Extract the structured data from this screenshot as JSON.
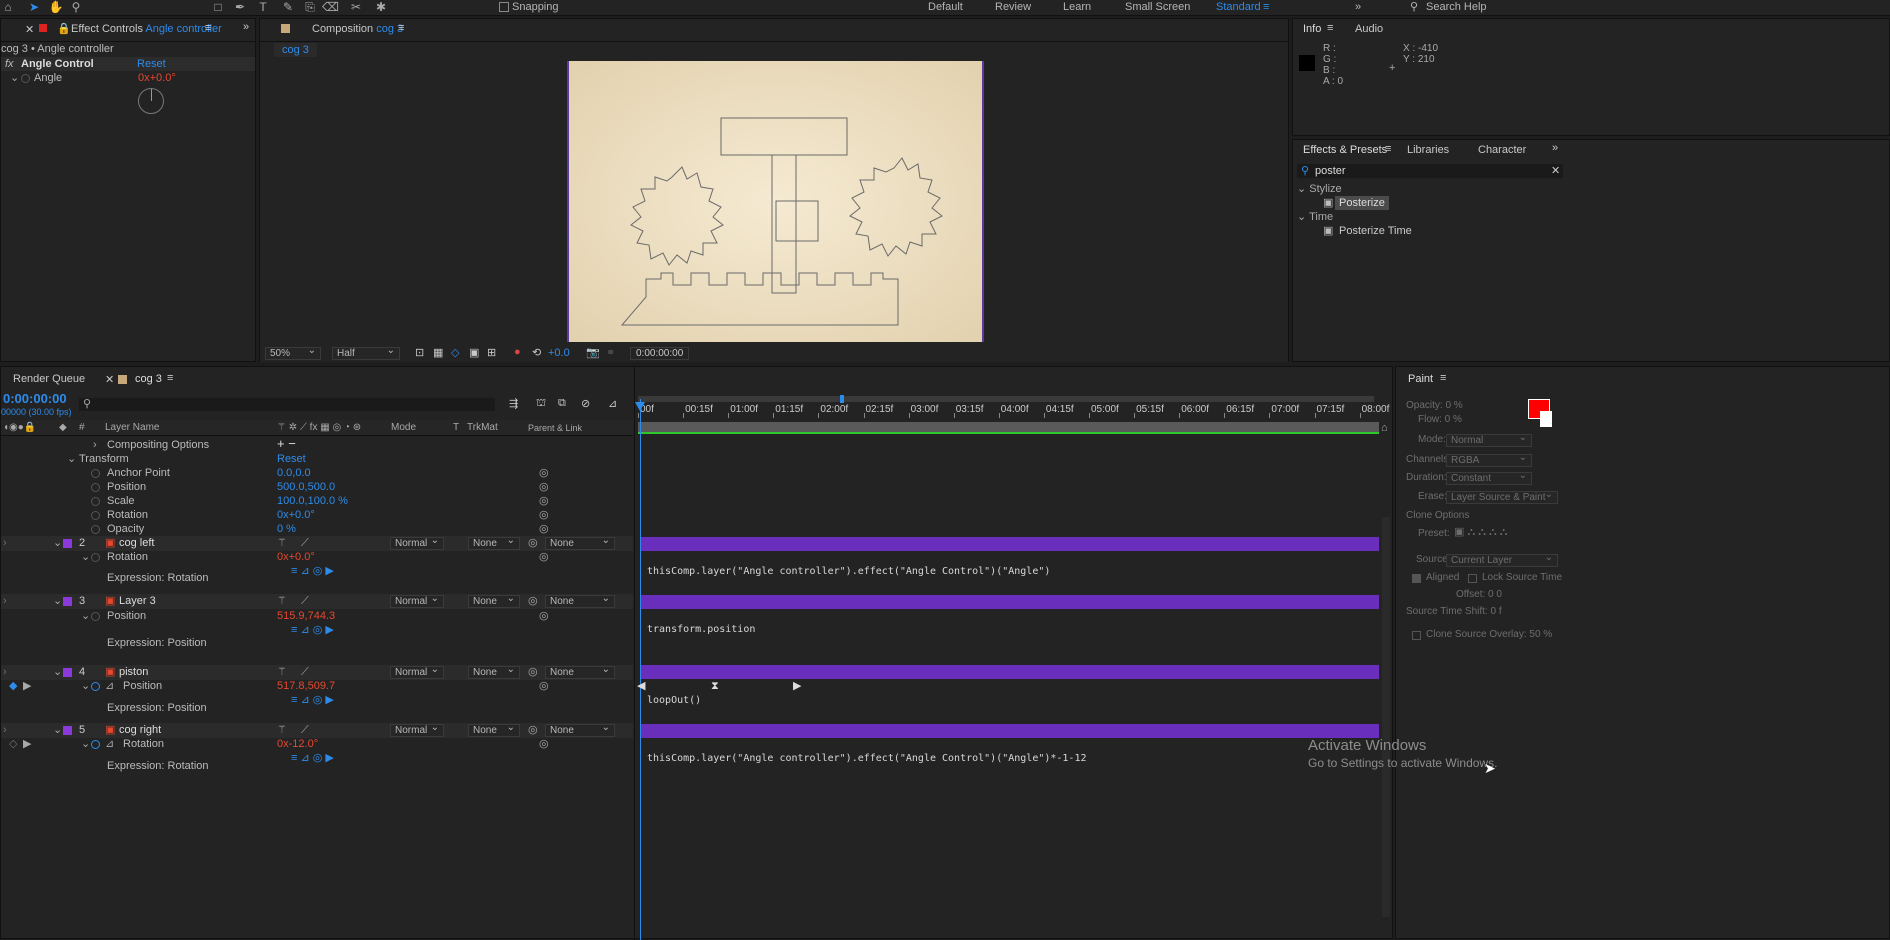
{
  "toolbar": {
    "snapping": "Snapping",
    "workspaces": [
      "Default",
      "Review",
      "Learn",
      "Small Screen",
      "Standard"
    ],
    "active_workspace": "Standard",
    "search_placeholder": "Search Help"
  },
  "effect_controls": {
    "tab_prefix": "Effect Controls",
    "tab_layer": "Angle controller",
    "breadcrumb": "cog 3 • Angle controller",
    "effect_name": "Angle Control",
    "reset": "Reset",
    "prop": "Angle",
    "value": "0x+0.0°"
  },
  "composition": {
    "tab_prefix": "Composition",
    "tab_name": "cog 3",
    "subtab": "cog 3",
    "zoom": "50%",
    "resolution": "Half",
    "exposure": "+0.0",
    "timecode": "0:00:00:00"
  },
  "info": {
    "tabs": [
      "Info",
      "Audio"
    ],
    "r": "R :",
    "g": "G :",
    "b": "B :",
    "a": "A : 0",
    "x": "X : -410",
    "y": "Y : 210"
  },
  "effects_presets": {
    "tabs": [
      "Effects & Presets",
      "Libraries",
      "Character"
    ],
    "search": "poster",
    "groups": [
      {
        "name": "Stylize",
        "item": "Posterize"
      },
      {
        "name": "Time",
        "item": "Posterize Time"
      }
    ]
  },
  "timeline": {
    "tabs": [
      "Render Queue",
      "cog 3"
    ],
    "timecode": "0:00:00:00",
    "fps": "00000 (30.00 fps)",
    "cols": {
      "layer_name": "Layer Name",
      "mode": "Mode",
      "t": "T",
      "trkmat": "TrkMat",
      "parent": "Parent & Link"
    },
    "ruler": [
      "00f",
      "00:15f",
      "01:00f",
      "01:15f",
      "02:00f",
      "02:15f",
      "03:00f",
      "03:15f",
      "04:00f",
      "04:15f",
      "05:00f",
      "05:15f",
      "06:00f",
      "06:15f",
      "07:00f",
      "07:15f",
      "08:00f"
    ],
    "compositing": "Compositing Options",
    "transform": "Transform",
    "reset": "Reset",
    "transform_props": [
      {
        "name": "Anchor Point",
        "value": "0.0,0.0"
      },
      {
        "name": "Position",
        "value": "500.0,500.0"
      },
      {
        "name": "Scale",
        "value": "100.0,100.0 %"
      },
      {
        "name": "Rotation",
        "value": "0x+0.0°"
      },
      {
        "name": "Opacity",
        "value": "0 %"
      }
    ],
    "layers": [
      {
        "num": "2",
        "name": "cog left",
        "mode": "Normal",
        "trk": "None",
        "parent": "None",
        "prop": "Rotation",
        "value": "0x+0.0°",
        "expr_label": "Expression: Rotation",
        "expr": "thisComp.layer(\"Angle controller\").effect(\"Angle Control\")(\"Angle\")"
      },
      {
        "num": "3",
        "name": "Layer 3",
        "mode": "Normal",
        "trk": "None",
        "parent": "None",
        "prop": "Position",
        "value": "515.9,744.3",
        "expr_label": "Expression: Position",
        "expr": "transform.position"
      },
      {
        "num": "4",
        "name": "piston",
        "mode": "Normal",
        "trk": "None",
        "parent": "None",
        "prop": "Position",
        "value": "517.8,509.7",
        "expr_label": "Expression: Position",
        "expr": "loopOut()"
      },
      {
        "num": "5",
        "name": "cog right",
        "mode": "Normal",
        "trk": "None",
        "parent": "None",
        "prop": "Rotation",
        "value": "0x-12.0°",
        "expr_label": "Expression: Rotation",
        "expr": "thisComp.layer(\"Angle controller\").effect(\"Angle Control\")(\"Angle\")*-1-12"
      }
    ]
  },
  "paint": {
    "title": "Paint",
    "opacity": "Opacity:  0 %",
    "flow": "Flow:  0 %",
    "mode": "Mode:",
    "mode_val": "Normal",
    "channels": "Channels:",
    "channels_val": "RGBA",
    "duration": "Duration:",
    "duration_val": "Constant",
    "erase": "Erase:",
    "erase_val": "Layer Source & Paint",
    "clone": "Clone Options",
    "preset": "Preset:",
    "source": "Source:",
    "source_val": "Current Layer",
    "aligned": "Aligned",
    "lock": "Lock Source Time",
    "offset": "Offset:  0          0",
    "shift": "Source Time Shift:  0  f",
    "overlay": "Clone Source Overlay:  50 %"
  },
  "watermark": {
    "line1": "Activate Windows",
    "line2": "Go to Settings to activate Windows."
  }
}
